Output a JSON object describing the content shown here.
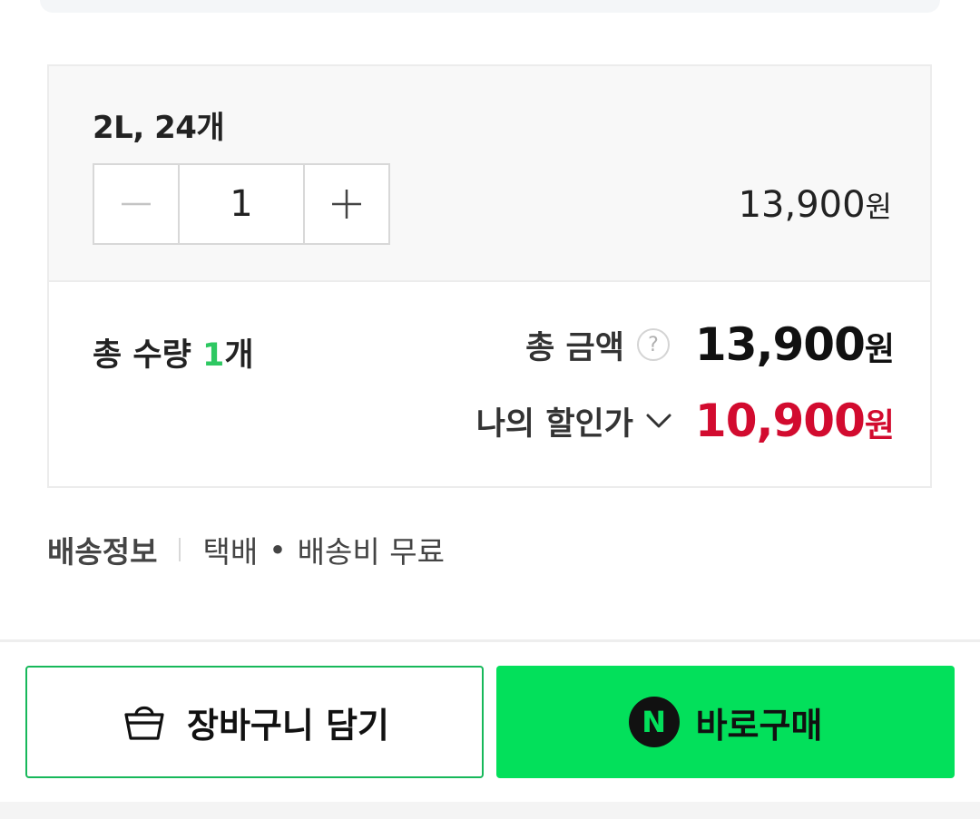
{
  "option": {
    "name": "2L, 24개",
    "quantity": "1",
    "price": "13,900",
    "price_unit": "원"
  },
  "summary": {
    "total_qty_label": "총 수량 ",
    "total_qty_count": "1",
    "total_qty_unit": "개",
    "total_amount_label": "총 금액",
    "help_icon_glyph": "?",
    "total_amount_value": "13,900",
    "total_amount_unit": "원",
    "discount_label": "나의 할인가",
    "discount_value": "10,900",
    "discount_unit": "원"
  },
  "shipping": {
    "label": "배송정보",
    "method": "택배",
    "dot": "•",
    "fee": "배송비 무료"
  },
  "actions": {
    "cart_label": "장바구니 담기",
    "buy_label": "바로구매",
    "naver_glyph": "N"
  },
  "colors": {
    "accent_green": "#03e05b",
    "count_green": "#2ec862",
    "discount_red": "#d20b2f",
    "cart_border": "#17b85a"
  },
  "icons": {
    "minus": "minus-icon",
    "plus": "plus-icon",
    "help": "question-circle-icon",
    "chevron": "chevron-down-icon",
    "cart": "shopping-bag-icon",
    "naver": "naver-n-icon"
  }
}
